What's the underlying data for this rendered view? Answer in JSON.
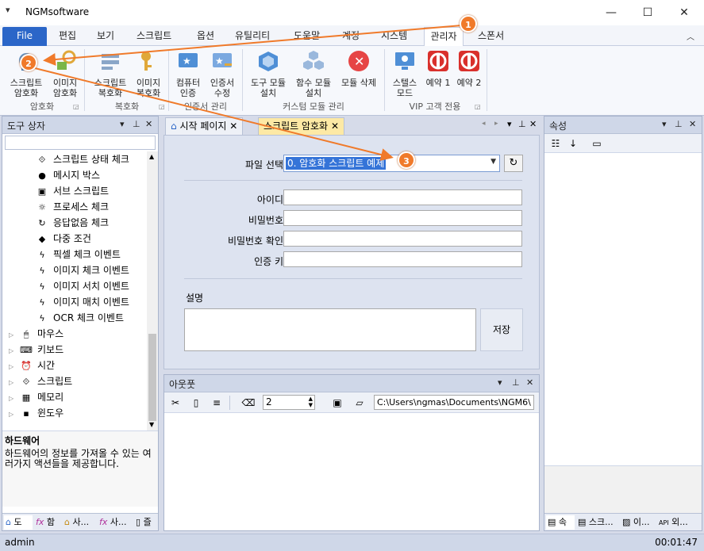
{
  "window": {
    "title": "NGMsoftware",
    "qat_icon": "▾",
    "minimize": "—",
    "maximize": "☐",
    "close": "✕"
  },
  "ribbon_tabs": [
    "File",
    "편집",
    "보기",
    "스크립트",
    "옵션",
    "유틸리티",
    "도움말",
    "계정",
    "시스템",
    "관리자",
    "스폰서"
  ],
  "ribbon": {
    "groups": [
      {
        "label": "암호화",
        "buttons": [
          {
            "l1": "스크립트",
            "l2": "암호화"
          },
          {
            "l1": "이미지",
            "l2": "암호화"
          }
        ]
      },
      {
        "label": "복호화",
        "buttons": [
          {
            "l1": "스크립트",
            "l2": "복호화"
          },
          {
            "l1": "이미지",
            "l2": "복호화"
          }
        ]
      },
      {
        "label": "인증서 관리",
        "buttons": [
          {
            "l1": "컴퓨터",
            "l2": "인증"
          },
          {
            "l1": "인증서",
            "l2": "수정"
          }
        ]
      },
      {
        "label": "커스텀 모듈 관리",
        "buttons": [
          {
            "l1": "도구 모듈",
            "l2": "설치"
          },
          {
            "l1": "함수 모듈",
            "l2": "설치"
          },
          {
            "l1": "모듈 삭제",
            "l2": ""
          }
        ]
      },
      {
        "label": "VIP 고객 전용",
        "buttons": [
          {
            "l1": "스텔스",
            "l2": "모드"
          },
          {
            "l1": "예약 1",
            "l2": ""
          },
          {
            "l1": "예약 2",
            "l2": ""
          }
        ]
      }
    ]
  },
  "toolbox": {
    "title": "도구 상자",
    "items": [
      {
        "icon": "⟐",
        "label": "스크립트 상태 체크"
      },
      {
        "icon": "●",
        "label": "메시지 박스"
      },
      {
        "icon": "▣",
        "label": "서브 스크립트"
      },
      {
        "icon": "☼",
        "label": "프로세스 체크"
      },
      {
        "icon": "↻",
        "label": "응답없음 체크"
      },
      {
        "icon": "◆",
        "label": "다중 조건"
      },
      {
        "icon": "ϟ",
        "label": "픽셀 체크 이벤트"
      },
      {
        "icon": "ϟ",
        "label": "이미지 체크 이벤트"
      },
      {
        "icon": "ϟ",
        "label": "이미지 서치 이벤트"
      },
      {
        "icon": "ϟ",
        "label": "이미지 매치 이벤트"
      },
      {
        "icon": "ϟ",
        "label": "OCR 체크 이벤트"
      }
    ],
    "categories": [
      {
        "icon": "🖱",
        "label": "마우스"
      },
      {
        "icon": "⌨",
        "label": "키보드"
      },
      {
        "icon": "⏰",
        "label": "시간"
      },
      {
        "icon": "⟐",
        "label": "스크립트"
      },
      {
        "icon": "▦",
        "label": "메모리"
      },
      {
        "icon": "▪",
        "label": "윈도우"
      }
    ],
    "desc_title": "하드웨어",
    "desc_text": "하드웨어의 정보를 가져올 수 있는 여러가지 액션들을 제공합니다.",
    "bottom_tabs": [
      "도",
      "함",
      "사...",
      "사...",
      "즐"
    ]
  },
  "doc": {
    "tabs": [
      "시작 페이지",
      "스크립트 암호화"
    ],
    "file_label": "파일 선택",
    "file_value": "0. 암호화 스크립트 예제",
    "id_label": "아이디",
    "pw_label": "비밀번호",
    "pw_confirm_label": "비밀번호 확인",
    "auth_key_label": "인증 키",
    "desc_label": "설명",
    "save_label": "저장"
  },
  "output": {
    "title": "아웃풋",
    "number": "2",
    "path": "C:\\Users\\ngmas\\Documents\\NGM6\\"
  },
  "properties": {
    "title": "속성",
    "bottom_tabs": [
      "속",
      "스크...",
      "이...",
      "외..."
    ]
  },
  "status": {
    "user": "admin",
    "time": "00:01:47"
  },
  "markers": [
    "1",
    "2",
    "3"
  ],
  "colors": {
    "accent": "#2b66c8",
    "marker": "#f07a2a",
    "selection": "#3574d8",
    "active_tab": "#fde9a5"
  }
}
